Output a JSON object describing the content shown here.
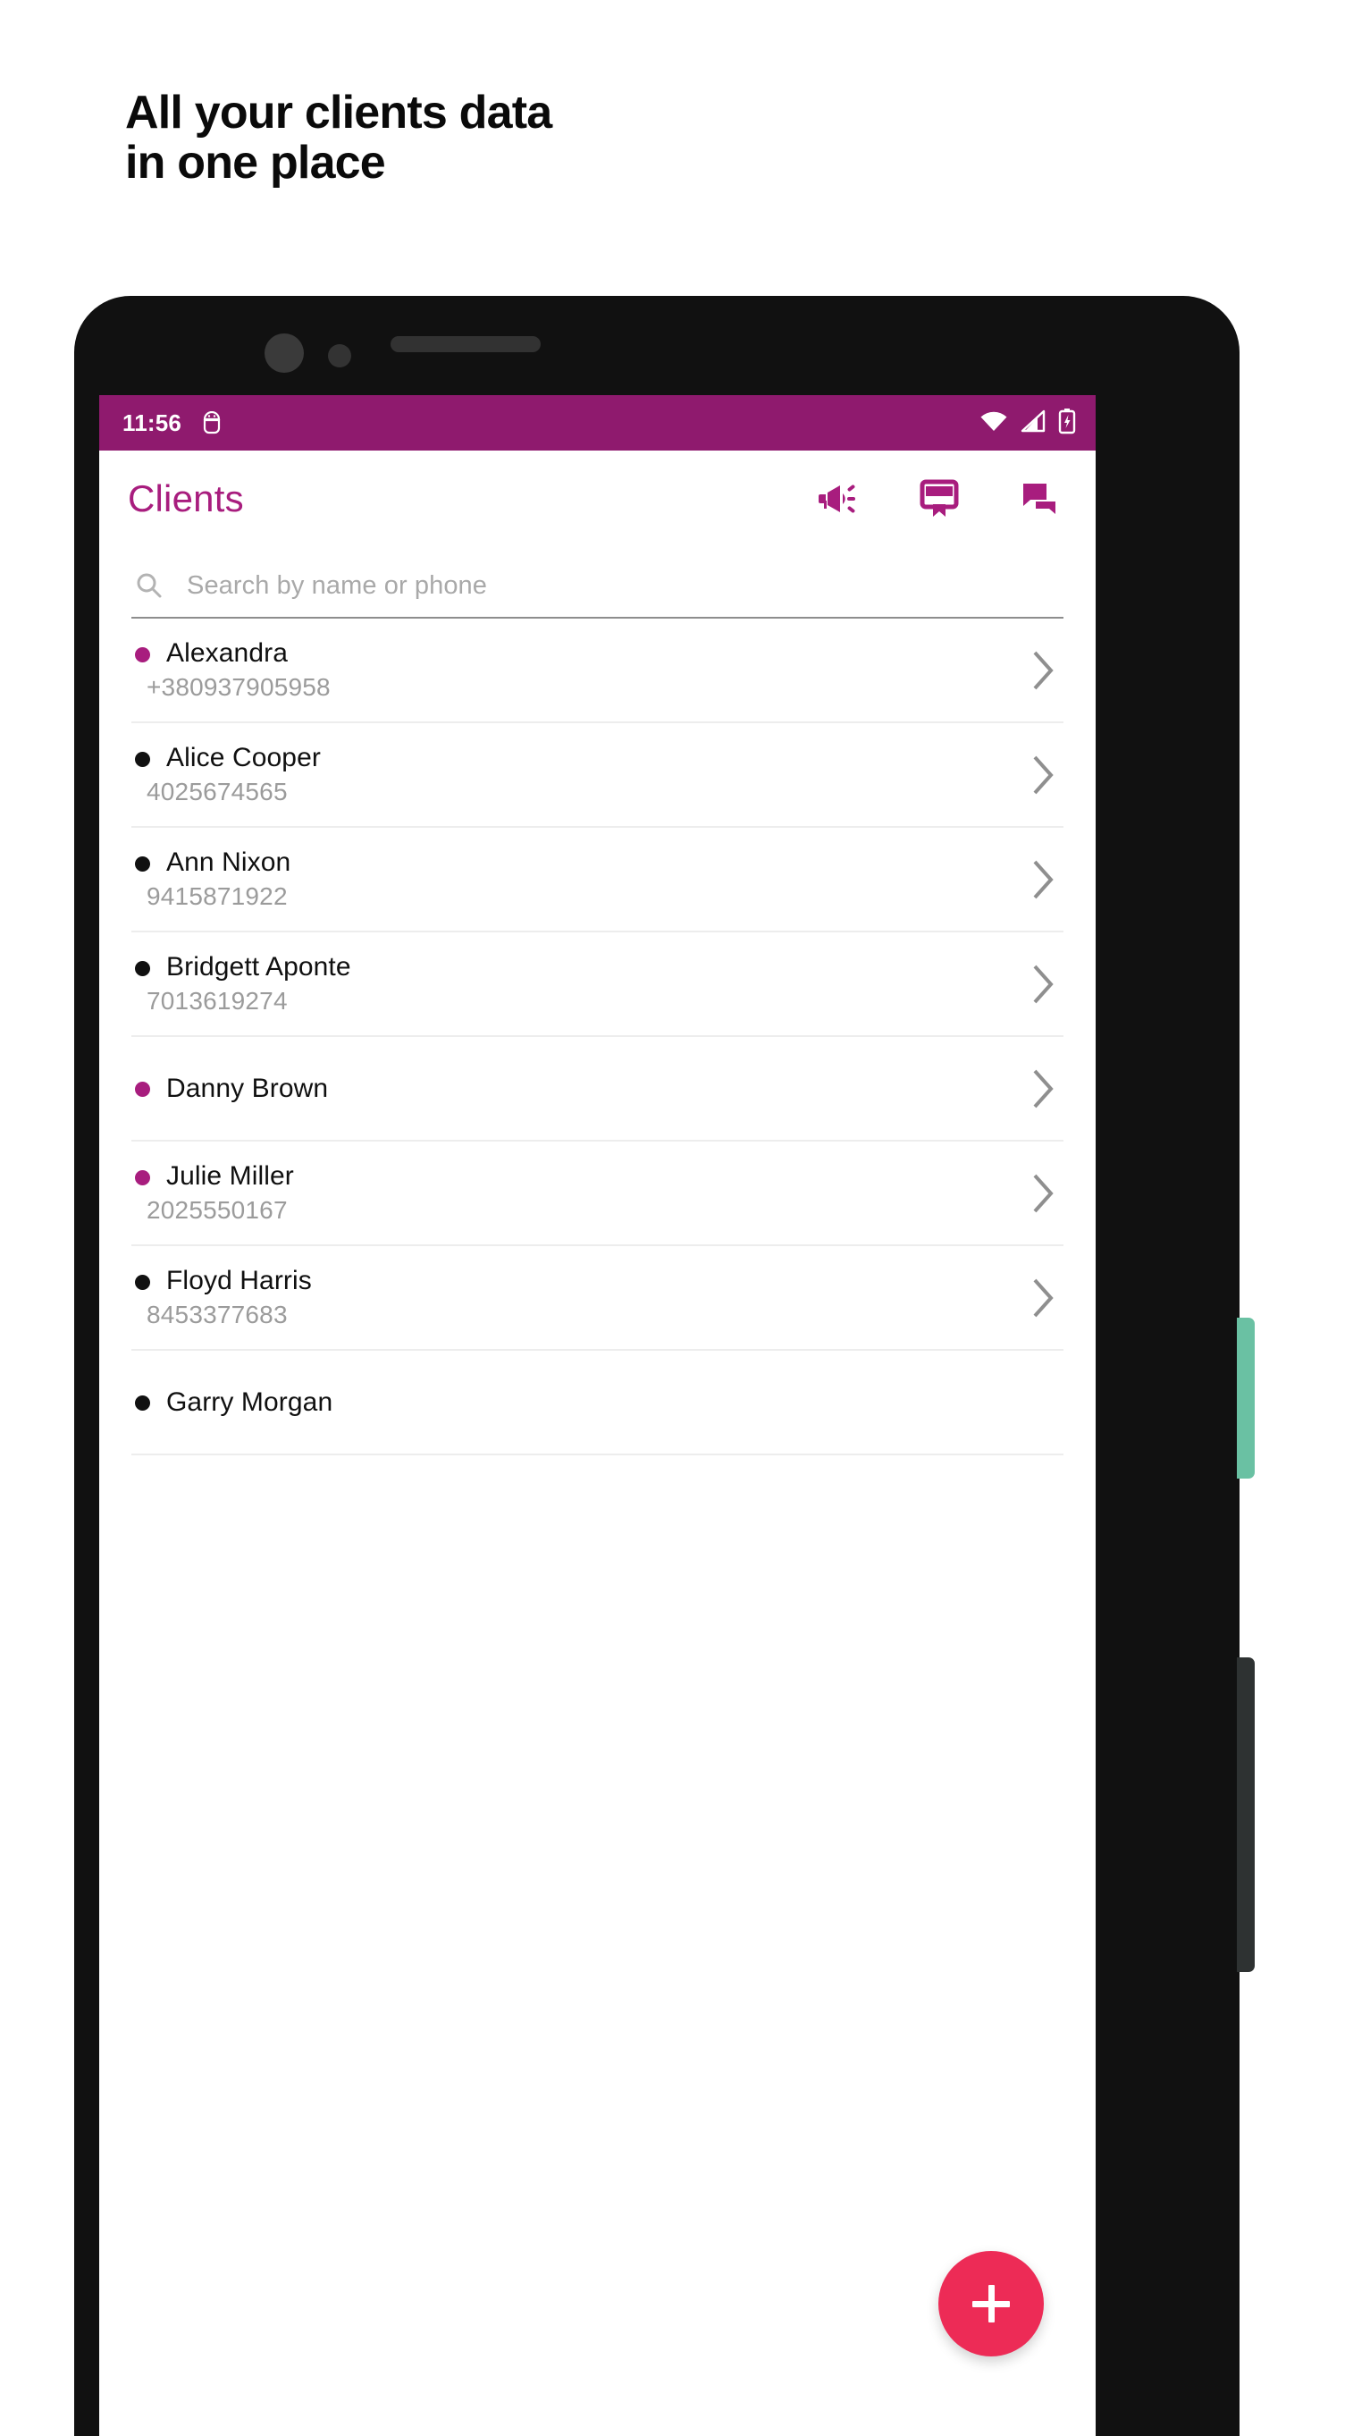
{
  "headline": {
    "line1": "All your clients data",
    "line2": "in one place"
  },
  "colors": {
    "brand_magenta": "#a81d7e",
    "status_bar": "#8f1a6e",
    "fab_pink": "#ed2b56",
    "side_button_green": "#6ac1a3",
    "dot_active": "#a81d7e",
    "dot_inactive": "#111111"
  },
  "status_bar": {
    "time": "11:56",
    "left_icon": "android-bug-icon",
    "right_icons": [
      "wifi-icon",
      "cellular-signal-icon",
      "battery-charging-icon"
    ]
  },
  "app_bar": {
    "title": "Clients",
    "actions": [
      {
        "name": "megaphone-icon",
        "label": "Announcements"
      },
      {
        "name": "bookmark-card-icon",
        "label": "Loyalty cards"
      },
      {
        "name": "chat-bubbles-icon",
        "label": "Messages"
      }
    ]
  },
  "search": {
    "placeholder": "Search by name or phone",
    "value": "",
    "icon": "search-icon"
  },
  "clients": [
    {
      "name": "Alexandra",
      "phone": "+380937905958",
      "status": "active"
    },
    {
      "name": "Alice Cooper",
      "phone": "4025674565",
      "status": "inactive"
    },
    {
      "name": "Ann Nixon",
      "phone": "9415871922",
      "status": "inactive"
    },
    {
      "name": "Bridgett Aponte",
      "phone": "7013619274",
      "status": "inactive"
    },
    {
      "name": "Danny Brown",
      "phone": "",
      "status": "active"
    },
    {
      "name": "Julie Miller",
      "phone": "2025550167",
      "status": "active"
    },
    {
      "name": "Floyd Harris",
      "phone": "8453377683",
      "status": "inactive"
    },
    {
      "name": "Garry Morgan",
      "phone": "",
      "status": "inactive"
    }
  ],
  "fab": {
    "icon": "plus-icon",
    "label": "Add client"
  }
}
